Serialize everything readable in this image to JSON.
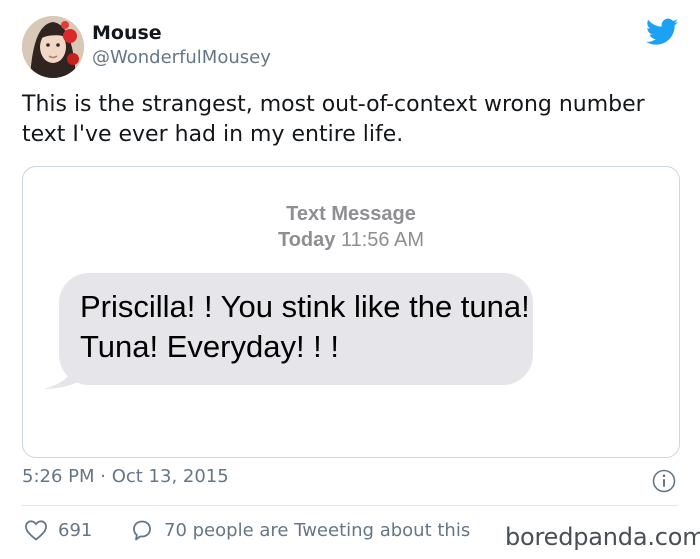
{
  "author": {
    "name": "Mouse",
    "handle": "@WonderfulMousey"
  },
  "icons": {
    "brand": "twitter-bird-icon",
    "info": "info-icon",
    "like": "heart-icon",
    "reply": "chat-bubble-icon"
  },
  "colors": {
    "twitter_blue": "#1da1f2",
    "muted_text": "#657786",
    "bubble_gray": "#e5e5ea"
  },
  "tweet": {
    "text": "This is the strangest, most out-of-context wrong number text I've ever had in my entire life."
  },
  "sms": {
    "header": "Text Message",
    "date_label": "Today",
    "time": "11:56 AM",
    "message": "Priscilla! ! You stink like the tuna! Tuna! Everyday! ! !"
  },
  "footer": {
    "timestamp": "5:26 PM · Oct 13, 2015",
    "likes": "691",
    "conversation": "70 people are Tweeting about this"
  },
  "watermark": "boredpanda.com"
}
